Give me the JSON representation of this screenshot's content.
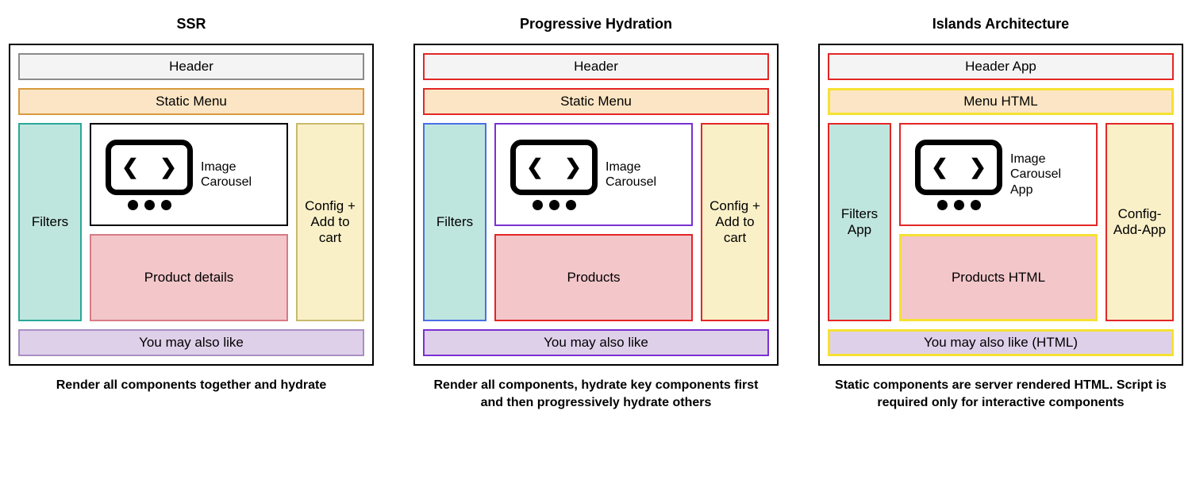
{
  "columns": [
    {
      "id": "ssr",
      "title": "SSR",
      "header": "Header",
      "menu": "Static Menu",
      "filters": "Filters",
      "carousel": "Image Carousel",
      "products": "Product details",
      "config": "Config + Add to cart",
      "footer": "You may also like",
      "caption": "Render all components together and hydrate"
    },
    {
      "id": "progressive",
      "title": "Progressive Hydration",
      "header": "Header",
      "menu": "Static Menu",
      "filters": "Filters",
      "carousel": "Image Carousel",
      "products": "Products",
      "config": "Config + Add to cart",
      "footer": "You may also like",
      "caption": "Render all components, hydrate key components first and then progressively hydrate others"
    },
    {
      "id": "islands",
      "title": "Islands Architecture",
      "header": "Header App",
      "menu": "Menu HTML",
      "filters": "Filters App",
      "carousel": "Image Carousel App",
      "products": "Products HTML",
      "config": "Config-Add-App",
      "footer": "You may also like (HTML)",
      "caption": "Static components are server rendered HTML. Script is required only for interactive components"
    }
  ]
}
